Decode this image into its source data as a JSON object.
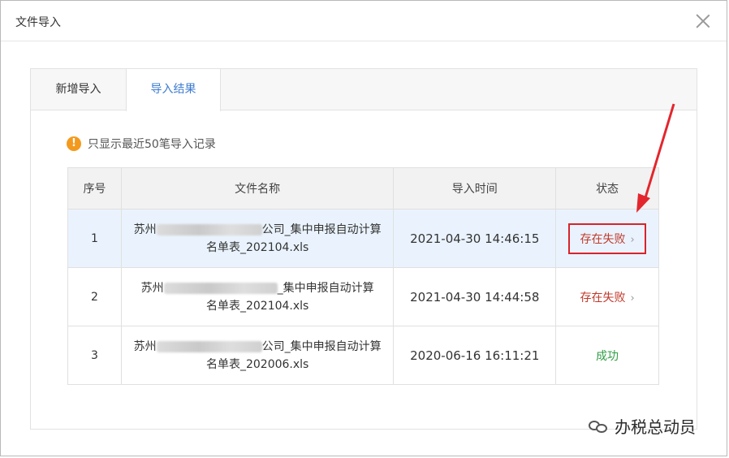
{
  "dialog": {
    "title": "文件导入"
  },
  "tabs": [
    {
      "label": "新增导入"
    },
    {
      "label": "导入结果"
    }
  ],
  "notice": {
    "text": "只显示最近50笔导入记录",
    "icon": "warning-icon"
  },
  "table": {
    "headers": [
      "序号",
      "文件名称",
      "导入时间",
      "状态"
    ],
    "rows": [
      {
        "index": "1",
        "name_prefix": "苏州",
        "name_mid": "公司_集中申报自动计算",
        "name_line2": "名单表_202104.xls",
        "time": "2021-04-30 14:46:15",
        "status": "存在失败"
      },
      {
        "index": "2",
        "name_prefix": "苏州",
        "name_mid": "_集中申报自动计算",
        "name_line2": "名单表_202104.xls",
        "time": "2021-04-30 14:44:58",
        "status": "存在失败"
      },
      {
        "index": "3",
        "name_prefix": "苏州",
        "name_mid": "公司_集中申报自动计算",
        "name_line2": "名单表_202006.xls",
        "time": "2020-06-16 16:11:21",
        "status": "成功"
      }
    ],
    "chevron": "›"
  },
  "colors": {
    "accent": "#3b7bd1",
    "fail": "#c0392b",
    "success": "#2f9e44",
    "annotation": "#d9232b"
  },
  "watermark": {
    "text": "办税总动员"
  }
}
